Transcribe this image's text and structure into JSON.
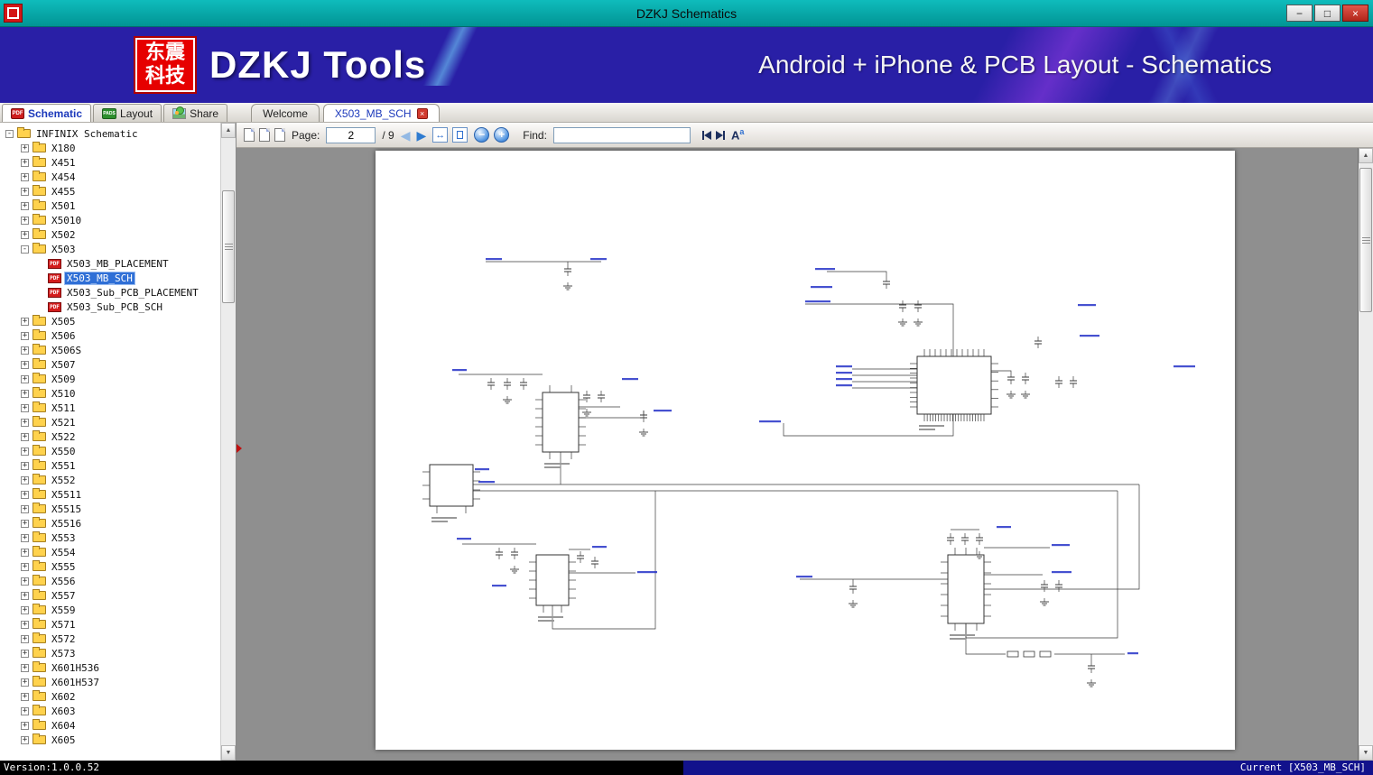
{
  "window": {
    "title": "DZKJ Schematics",
    "buttons": {
      "minimize": "−",
      "maximize": "□",
      "close": "×"
    }
  },
  "banner": {
    "logo_top": "东震",
    "logo_bottom": "科技",
    "app_title": "DZKJ Tools",
    "subtitle": "Android + iPhone & PCB Layout - Schematics"
  },
  "ribbon": {
    "tabs": [
      {
        "label": "Schematic",
        "icon": "pdf-icon"
      },
      {
        "label": "Layout",
        "icon": "pads-icon"
      },
      {
        "label": "Share",
        "icon": "share-icon"
      }
    ]
  },
  "doc_tabs": [
    {
      "label": "Welcome",
      "active": false
    },
    {
      "label": "X503_MB_SCH",
      "active": true,
      "close_icon": "×"
    }
  ],
  "toolbar": {
    "page_label": "Page:",
    "page_value": "2",
    "page_total": "/ 9",
    "prev": "◀",
    "next": "▶",
    "fit_width_icon": "↔",
    "zoom_out": "−",
    "zoom_in": "+",
    "find_label": "Find:",
    "find_value": "",
    "font_icon_large": "A",
    "font_icon_small": "a"
  },
  "icons": {
    "scroll_up": "▲",
    "scroll_down": "▼"
  },
  "tree": {
    "items": [
      {
        "label": "INFINIX Schematic",
        "level": 0,
        "type": "folder",
        "expand": "minus"
      },
      {
        "label": "X180",
        "level": 1,
        "type": "folder",
        "expand": "plus"
      },
      {
        "label": "X451",
        "level": 1,
        "type": "folder",
        "expand": "plus"
      },
      {
        "label": "X454",
        "level": 1,
        "type": "folder",
        "expand": "plus"
      },
      {
        "label": "X455",
        "level": 1,
        "type": "folder",
        "expand": "plus"
      },
      {
        "label": "X501",
        "level": 1,
        "type": "folder",
        "expand": "plus"
      },
      {
        "label": "X5010",
        "level": 1,
        "type": "folder",
        "expand": "plus"
      },
      {
        "label": "X502",
        "level": 1,
        "type": "folder",
        "expand": "plus"
      },
      {
        "label": "X503",
        "level": 1,
        "type": "folder",
        "expand": "minus"
      },
      {
        "label": "X503_MB_PLACEMENT",
        "level": 2,
        "type": "pdf"
      },
      {
        "label": "X503_MB_SCH",
        "level": 2,
        "type": "pdf",
        "selected": true
      },
      {
        "label": "X503_Sub_PCB_PLACEMENT",
        "level": 2,
        "type": "pdf"
      },
      {
        "label": "X503_Sub_PCB_SCH",
        "level": 2,
        "type": "pdf"
      },
      {
        "label": "X505",
        "level": 1,
        "type": "folder",
        "expand": "plus"
      },
      {
        "label": "X506",
        "level": 1,
        "type": "folder",
        "expand": "plus"
      },
      {
        "label": "X506S",
        "level": 1,
        "type": "folder",
        "expand": "plus"
      },
      {
        "label": "X507",
        "level": 1,
        "type": "folder",
        "expand": "plus"
      },
      {
        "label": "X509",
        "level": 1,
        "type": "folder",
        "expand": "plus"
      },
      {
        "label": "X510",
        "level": 1,
        "type": "folder",
        "expand": "plus"
      },
      {
        "label": "X511",
        "level": 1,
        "type": "folder",
        "expand": "plus"
      },
      {
        "label": "X521",
        "level": 1,
        "type": "folder",
        "expand": "plus"
      },
      {
        "label": "X522",
        "level": 1,
        "type": "folder",
        "expand": "plus"
      },
      {
        "label": "X550",
        "level": 1,
        "type": "folder",
        "expand": "plus"
      },
      {
        "label": "X551",
        "level": 1,
        "type": "folder",
        "expand": "plus"
      },
      {
        "label": "X552",
        "level": 1,
        "type": "folder",
        "expand": "plus"
      },
      {
        "label": "X5511",
        "level": 1,
        "type": "folder",
        "expand": "plus"
      },
      {
        "label": "X5515",
        "level": 1,
        "type": "folder",
        "expand": "plus"
      },
      {
        "label": "X5516",
        "level": 1,
        "type": "folder",
        "expand": "plus"
      },
      {
        "label": "X553",
        "level": 1,
        "type": "folder",
        "expand": "plus"
      },
      {
        "label": "X554",
        "level": 1,
        "type": "folder",
        "expand": "plus"
      },
      {
        "label": "X555",
        "level": 1,
        "type": "folder",
        "expand": "plus"
      },
      {
        "label": "X556",
        "level": 1,
        "type": "folder",
        "expand": "plus"
      },
      {
        "label": "X557",
        "level": 1,
        "type": "folder",
        "expand": "plus"
      },
      {
        "label": "X559",
        "level": 1,
        "type": "folder",
        "expand": "plus"
      },
      {
        "label": "X571",
        "level": 1,
        "type": "folder",
        "expand": "plus"
      },
      {
        "label": "X572",
        "level": 1,
        "type": "folder",
        "expand": "plus"
      },
      {
        "label": "X573",
        "level": 1,
        "type": "folder",
        "expand": "plus"
      },
      {
        "label": "X601H536",
        "level": 1,
        "type": "folder",
        "expand": "plus"
      },
      {
        "label": "X601H537",
        "level": 1,
        "type": "folder",
        "expand": "plus"
      },
      {
        "label": "X602",
        "level": 1,
        "type": "folder",
        "expand": "plus"
      },
      {
        "label": "X603",
        "level": 1,
        "type": "folder",
        "expand": "plus"
      },
      {
        "label": "X604",
        "level": 1,
        "type": "folder",
        "expand": "plus"
      },
      {
        "label": "X605",
        "level": 1,
        "type": "folder",
        "expand": "plus"
      }
    ]
  },
  "statusbar": {
    "version": "Version:1.0.0.52",
    "current": "Current [X503_MB_SCH]"
  }
}
